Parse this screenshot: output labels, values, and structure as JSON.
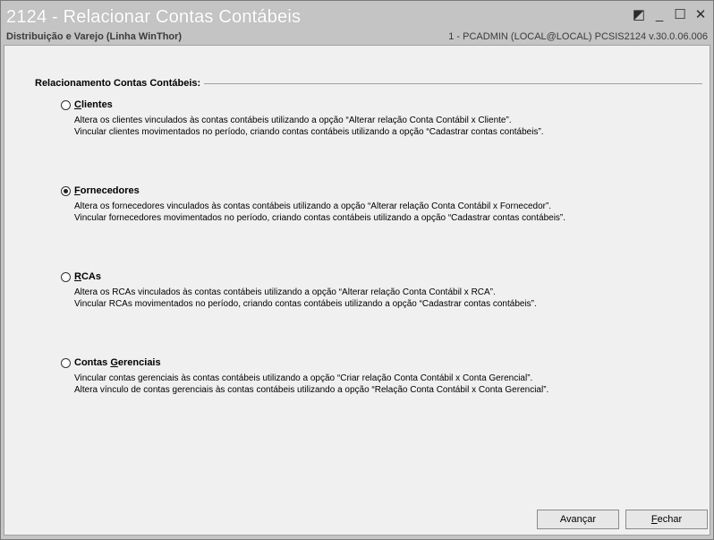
{
  "window": {
    "title": "2124 - Relacionar Contas Contábeis",
    "subtitle": "Distribuição e Varejo (Linha WinThor)",
    "status": "1 - PCADMIN (LOCAL@LOCAL)   PCSIS2124  v.30.0.06.006",
    "controls": {
      "restore": "◩",
      "minimize": "_",
      "maximize": "☐",
      "close": "✕"
    }
  },
  "group": {
    "title": "Relacionamento Contas Contábeis:"
  },
  "options": [
    {
      "label_first": "C",
      "label_rest": "lientes",
      "checked": false,
      "line1": "Altera os clientes vinculados às contas contábeis utilizando a opção “Alterar relação Conta Contábil x Cliente”.",
      "line2": "Vincular clientes movimentados no período, criando contas contábeis utilizando a opção “Cadastrar contas contábeis”."
    },
    {
      "label_first": "F",
      "label_rest": "ornecedores",
      "checked": true,
      "line1": "Altera os fornecedores vinculados às contas contábeis utilizando a opção “Alterar relação Conta Contábil x Fornecedor”.",
      "line2": "Vincular fornecedores movimentados no período, criando contas contábeis utilizando a opção “Cadastrar contas contábeis”."
    },
    {
      "label_first": "R",
      "label_rest": "CAs",
      "checked": false,
      "line1": "Altera os RCAs vinculados às contas contábeis utilizando a opção “Alterar relação Conta Contábil x RCA”.",
      "line2": "Vincular RCAs movimentados no período, criando contas contábeis utilizando a opção “Cadastrar contas contábeis”."
    },
    {
      "label_pre": "Contas ",
      "label_first": "G",
      "label_rest": "erenciais",
      "checked": false,
      "line1": "Vincular contas gerenciais às contas contábeis utilizando a opção “Criar relação Conta Contábil x Conta Gerencial”.",
      "line2": "Altera vínculo de contas gerenciais às contas contábeis utilizando a opção “Relação Conta Contábil x Conta Gerencial”."
    }
  ],
  "buttons": {
    "next_label": "Avançar",
    "close_first": "F",
    "close_rest": "echar"
  }
}
